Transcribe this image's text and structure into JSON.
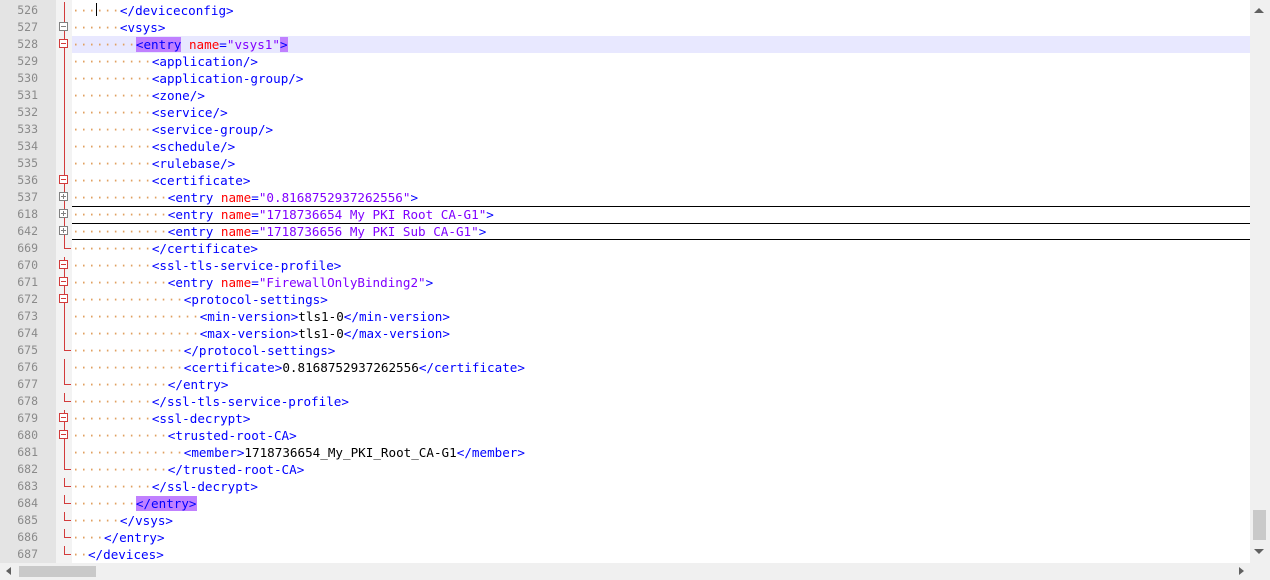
{
  "editor": {
    "lines": [
      {
        "num": "526",
        "indent": 3,
        "fold": "mid",
        "parts": [
          [
            "tag",
            "</deviceconfig>"
          ]
        ]
      },
      {
        "num": "527",
        "indent": 3,
        "fold": "minus-gray",
        "parts": [
          [
            "tag",
            "<vsys>"
          ]
        ]
      },
      {
        "num": "528",
        "indent": 4,
        "fold": "minus",
        "current": true,
        "parts": [
          [
            "tag-hl",
            "<entry"
          ],
          [
            "txt",
            " "
          ],
          [
            "attr",
            "name"
          ],
          [
            "tag",
            "="
          ],
          [
            "val",
            "\"vsys1\""
          ],
          [
            "tag-hl",
            ">"
          ]
        ]
      },
      {
        "num": "529",
        "indent": 5,
        "fold": "line",
        "parts": [
          [
            "tag",
            "<application/>"
          ]
        ]
      },
      {
        "num": "530",
        "indent": 5,
        "fold": "line",
        "parts": [
          [
            "tag",
            "<application-group/>"
          ]
        ]
      },
      {
        "num": "531",
        "indent": 5,
        "fold": "line",
        "parts": [
          [
            "tag",
            "<zone/>"
          ]
        ]
      },
      {
        "num": "532",
        "indent": 5,
        "fold": "line",
        "parts": [
          [
            "tag",
            "<service/>"
          ]
        ]
      },
      {
        "num": "533",
        "indent": 5,
        "fold": "line",
        "parts": [
          [
            "tag",
            "<service-group/>"
          ]
        ]
      },
      {
        "num": "534",
        "indent": 5,
        "fold": "line",
        "parts": [
          [
            "tag",
            "<schedule/>"
          ]
        ]
      },
      {
        "num": "535",
        "indent": 5,
        "fold": "line",
        "parts": [
          [
            "tag",
            "<rulebase/>"
          ]
        ]
      },
      {
        "num": "536",
        "indent": 5,
        "fold": "minus",
        "parts": [
          [
            "tag",
            "<certificate>"
          ]
        ]
      },
      {
        "num": "537",
        "indent": 6,
        "fold": "plus",
        "parts": [
          [
            "tag",
            "<entry"
          ],
          [
            "txt",
            " "
          ],
          [
            "attr",
            "name"
          ],
          [
            "tag",
            "="
          ],
          [
            "val",
            "\"0.8168752937262556\""
          ],
          [
            "tag",
            ">"
          ]
        ]
      },
      {
        "num": "618",
        "indent": 6,
        "fold": "plus",
        "sepTop": true,
        "parts": [
          [
            "tag",
            "<entry"
          ],
          [
            "txt",
            " "
          ],
          [
            "attr",
            "name"
          ],
          [
            "tag",
            "="
          ],
          [
            "val",
            "\"1718736654 My PKI Root CA-G1\""
          ],
          [
            "tag",
            ">"
          ]
        ]
      },
      {
        "num": "642",
        "indent": 6,
        "fold": "plus",
        "sepTop": true,
        "sepBottom": true,
        "parts": [
          [
            "tag",
            "<entry"
          ],
          [
            "txt",
            " "
          ],
          [
            "attr",
            "name"
          ],
          [
            "tag",
            "="
          ],
          [
            "val",
            "\"1718736656 My PKI Sub CA-G1\""
          ],
          [
            "tag",
            ">"
          ]
        ]
      },
      {
        "num": "669",
        "indent": 5,
        "fold": "end",
        "parts": [
          [
            "tag",
            "</certificate>"
          ]
        ]
      },
      {
        "num": "670",
        "indent": 5,
        "fold": "minus",
        "parts": [
          [
            "tag",
            "<ssl-tls-service-profile>"
          ]
        ]
      },
      {
        "num": "671",
        "indent": 6,
        "fold": "minus",
        "parts": [
          [
            "tag",
            "<entry"
          ],
          [
            "txt",
            " "
          ],
          [
            "attr",
            "name"
          ],
          [
            "tag",
            "="
          ],
          [
            "val",
            "\"FirewallOnlyBinding2\""
          ],
          [
            "tag",
            ">"
          ]
        ]
      },
      {
        "num": "672",
        "indent": 7,
        "fold": "minus",
        "parts": [
          [
            "tag",
            "<protocol-settings>"
          ]
        ]
      },
      {
        "num": "673",
        "indent": 8,
        "fold": "line",
        "parts": [
          [
            "tag",
            "<min-version>"
          ],
          [
            "txt",
            "tls1-0"
          ],
          [
            "tag",
            "</min-version>"
          ]
        ]
      },
      {
        "num": "674",
        "indent": 8,
        "fold": "line",
        "parts": [
          [
            "tag",
            "<max-version>"
          ],
          [
            "txt",
            "tls1-0"
          ],
          [
            "tag",
            "</max-version>"
          ]
        ]
      },
      {
        "num": "675",
        "indent": 7,
        "fold": "end",
        "parts": [
          [
            "tag",
            "</protocol-settings>"
          ]
        ]
      },
      {
        "num": "676",
        "indent": 7,
        "fold": "line",
        "parts": [
          [
            "tag",
            "<certificate>"
          ],
          [
            "txt",
            "0.8168752937262556"
          ],
          [
            "tag",
            "</certificate>"
          ]
        ]
      },
      {
        "num": "677",
        "indent": 6,
        "fold": "end",
        "parts": [
          [
            "tag",
            "</entry>"
          ]
        ]
      },
      {
        "num": "678",
        "indent": 5,
        "fold": "end",
        "parts": [
          [
            "tag",
            "</ssl-tls-service-profile>"
          ]
        ]
      },
      {
        "num": "679",
        "indent": 5,
        "fold": "minus",
        "parts": [
          [
            "tag",
            "<ssl-decrypt>"
          ]
        ]
      },
      {
        "num": "680",
        "indent": 6,
        "fold": "minus",
        "parts": [
          [
            "tag",
            "<trusted-root-CA>"
          ]
        ]
      },
      {
        "num": "681",
        "indent": 7,
        "fold": "line",
        "parts": [
          [
            "tag",
            "<member>"
          ],
          [
            "txt",
            "1718736654_My_PKI_Root_CA-G1"
          ],
          [
            "tag",
            "</member>"
          ]
        ]
      },
      {
        "num": "682",
        "indent": 6,
        "fold": "end",
        "parts": [
          [
            "tag",
            "</trusted-root-CA>"
          ]
        ]
      },
      {
        "num": "683",
        "indent": 5,
        "fold": "end",
        "parts": [
          [
            "tag",
            "</ssl-decrypt>"
          ]
        ]
      },
      {
        "num": "684",
        "indent": 4,
        "fold": "end",
        "parts": [
          [
            "tag-hl",
            "</entry>"
          ]
        ]
      },
      {
        "num": "685",
        "indent": 3,
        "fold": "end",
        "parts": [
          [
            "tag",
            "</vsys>"
          ]
        ]
      },
      {
        "num": "686",
        "indent": 2,
        "fold": "end",
        "parts": [
          [
            "tag",
            "</entry>"
          ]
        ]
      },
      {
        "num": "687",
        "indent": 1,
        "fold": "end",
        "parts": [
          [
            "tag",
            "</devices>"
          ]
        ]
      }
    ]
  },
  "colors": {
    "tag": "#0000ff",
    "attr": "#ff0000",
    "value": "#8000ff",
    "text": "#000000",
    "indent_dots": "#e0a060",
    "fold_marker": "#d23b3b",
    "current_line": "#e8e8ff",
    "brace_highlight": "#c080ff"
  },
  "icons": {
    "fold_minus": "minus-box-icon",
    "fold_plus": "plus-box-icon",
    "scroll_up": "arrow-up-icon",
    "scroll_down": "arrow-down-icon",
    "scroll_left": "arrow-left-icon",
    "scroll_right": "arrow-right-icon"
  }
}
